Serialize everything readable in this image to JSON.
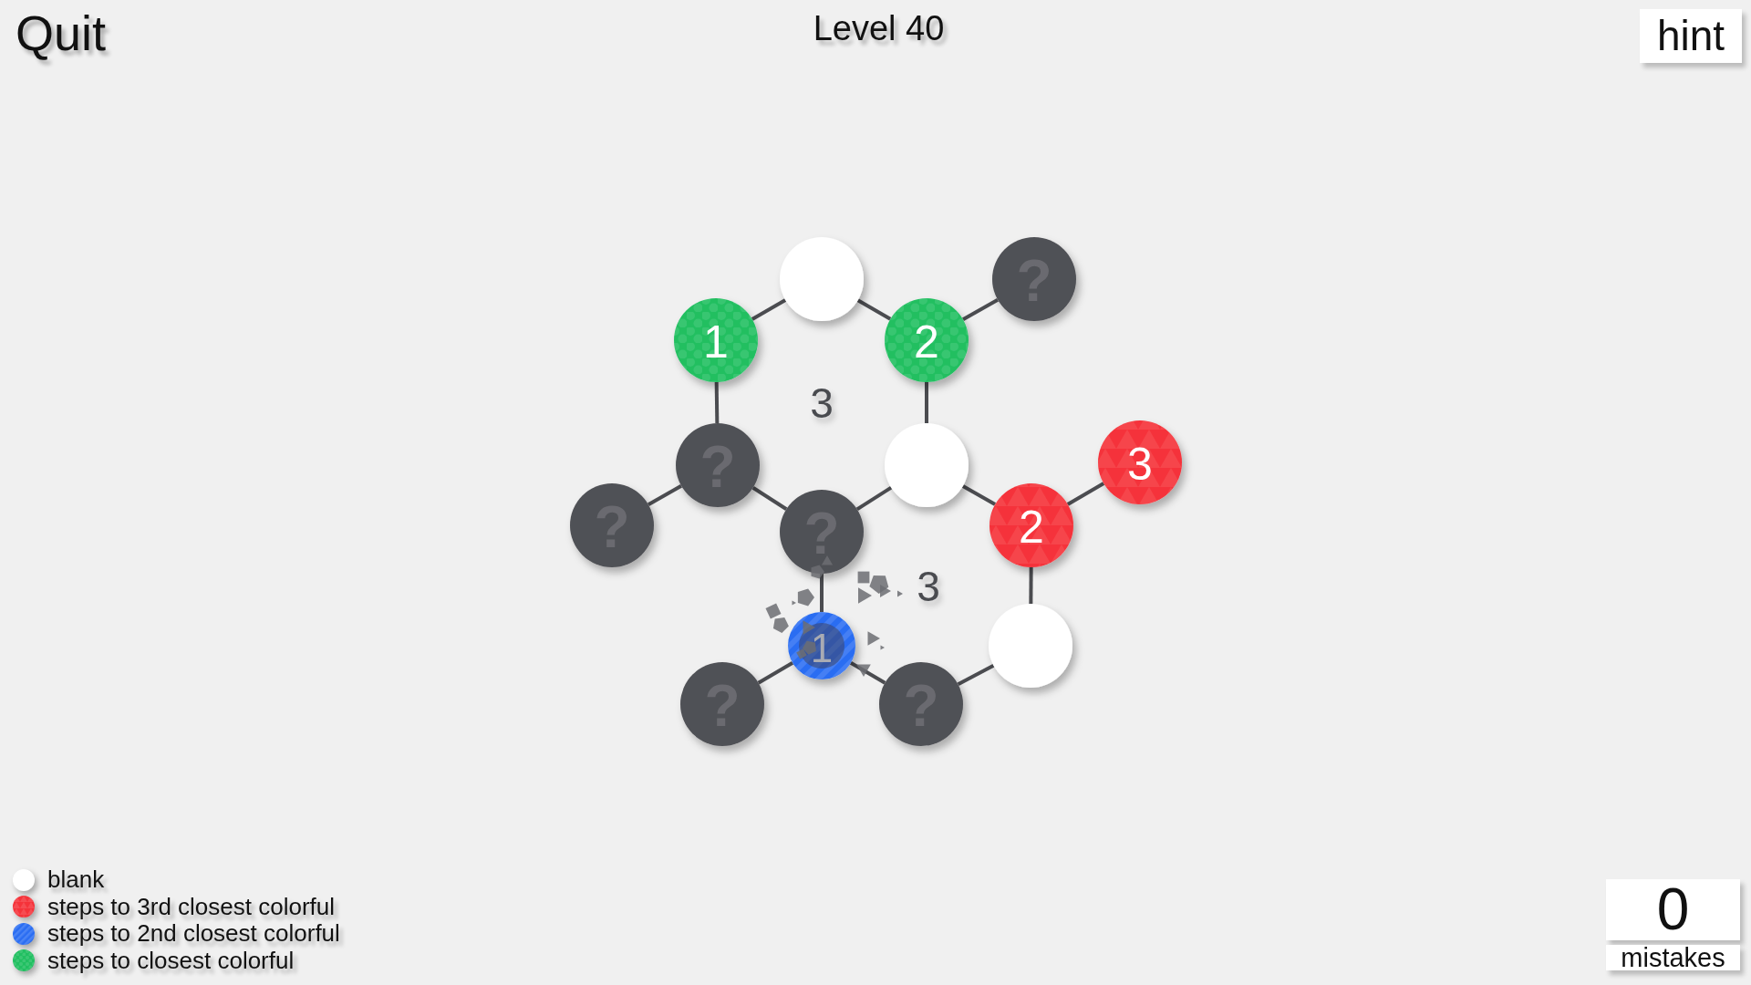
{
  "header": {
    "quit": "Quit",
    "level": "Level 40",
    "hint": "hint"
  },
  "graph": {
    "nodes": [
      {
        "kind": "blank",
        "revealing": false
      },
      {
        "kind": "unknown",
        "label": "?",
        "revealing": false
      },
      {
        "kind": "closest",
        "label": "1",
        "revealing": false
      },
      {
        "kind": "closest",
        "label": "2",
        "revealing": false
      },
      {
        "kind": "unknown",
        "label": "?",
        "revealing": false
      },
      {
        "kind": "blank",
        "revealing": false
      },
      {
        "kind": "third",
        "label": "3",
        "revealing": false
      },
      {
        "kind": "unknown",
        "label": "?",
        "revealing": false
      },
      {
        "kind": "unknown",
        "label": "?",
        "revealing": false
      },
      {
        "kind": "third",
        "label": "2",
        "revealing": false
      },
      {
        "kind": "second",
        "label": "1",
        "revealing": true
      },
      {
        "kind": "blank",
        "revealing": false
      },
      {
        "kind": "unknown",
        "label": "?",
        "revealing": false
      },
      {
        "kind": "unknown",
        "label": "?",
        "revealing": false
      }
    ],
    "region_hints": [
      "3",
      "3"
    ]
  },
  "legend": [
    {
      "kind": "blank",
      "color": "#ffffff",
      "label": "blank"
    },
    {
      "kind": "third",
      "color": "#f5333a",
      "label": "steps to 3rd closest colorful"
    },
    {
      "kind": "second",
      "color": "#2a6df2",
      "label": "steps to 2nd closest colorful"
    },
    {
      "kind": "closest",
      "color": "#21bf61",
      "label": "steps to closest colorful"
    }
  ],
  "mistakes": {
    "count": "0",
    "label": "mistakes"
  }
}
